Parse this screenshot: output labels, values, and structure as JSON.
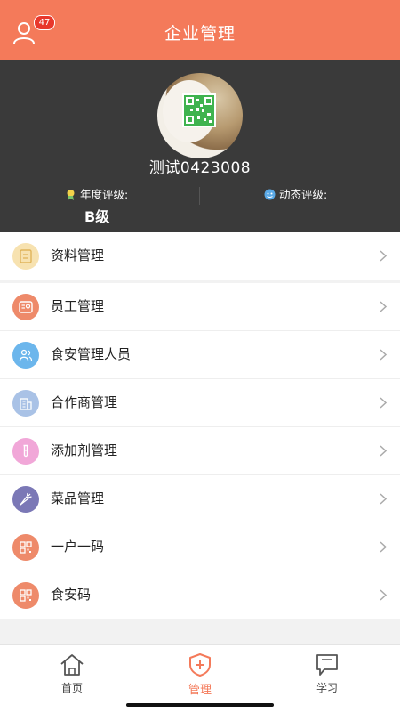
{
  "header": {
    "title": "企业管理",
    "badge": "47"
  },
  "profile": {
    "name": "测试0423008",
    "annual_rating_label": "年度评级:",
    "annual_rating_value": "B级",
    "dynamic_rating_label": "动态评级:"
  },
  "section1": [
    {
      "label": "资料管理",
      "icon": "document-icon",
      "color": "#f7e2b0"
    }
  ],
  "section2": [
    {
      "label": "员工管理",
      "icon": "employee-card-icon",
      "color": "#ee8a6a"
    },
    {
      "label": "食安管理人员",
      "icon": "people-icon",
      "color": "#6cb6ec"
    },
    {
      "label": "合作商管理",
      "icon": "building-icon",
      "color": "#a9c2e6"
    },
    {
      "label": "添加剂管理",
      "icon": "test-tube-icon",
      "color": "#f1a7d8"
    },
    {
      "label": "菜品管理",
      "icon": "carrot-icon",
      "color": "#7b78b6"
    },
    {
      "label": "一户一码",
      "icon": "qr-grid-icon",
      "color": "#ee8a6a"
    },
    {
      "label": "食安码",
      "icon": "qr-grid-icon",
      "color": "#ee8a6a"
    }
  ],
  "tabbar": [
    {
      "label": "首页",
      "icon": "home-icon",
      "active": false
    },
    {
      "label": "管理",
      "icon": "management-shield-icon",
      "active": true
    },
    {
      "label": "学习",
      "icon": "chat-screen-icon",
      "active": false
    }
  ],
  "colors": {
    "accent": "#f47a5a",
    "profile_bg": "#3a3a3a",
    "badge": "#e8382c"
  }
}
